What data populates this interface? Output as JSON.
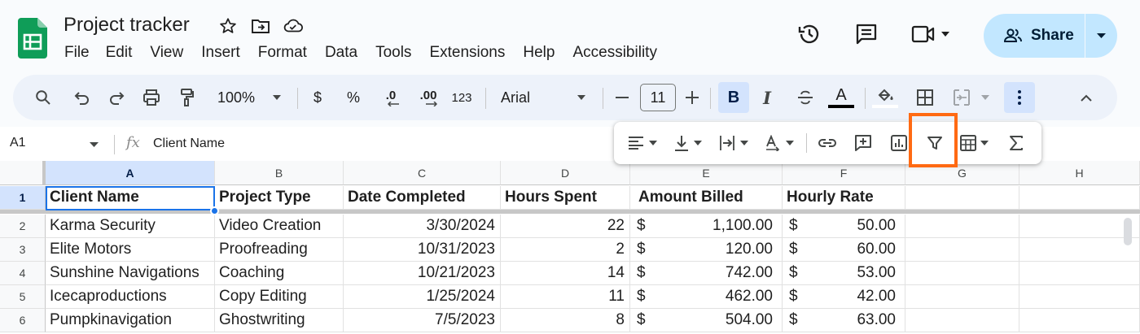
{
  "app": {
    "document_title": "Project tracker",
    "menu": [
      "File",
      "Edit",
      "View",
      "Insert",
      "Format",
      "Data",
      "Tools",
      "Extensions",
      "Help",
      "Accessibility"
    ],
    "share_label": "Share"
  },
  "toolbar": {
    "zoom": "100%",
    "currency": "$",
    "percent": "%",
    "decrease_decimal": ".0",
    "increase_decimal": ".00",
    "number_format": "123",
    "font": "Arial",
    "font_size": "11",
    "bold": "B",
    "italic": "I",
    "text_color": "A"
  },
  "formula_bar": {
    "name_box": "A1",
    "fx": "fx",
    "content": "Client Name"
  },
  "columns": [
    "A",
    "B",
    "C",
    "D",
    "E",
    "F",
    "G",
    "H"
  ],
  "rows": [
    {
      "num": "1",
      "cells": [
        "Client Name",
        "Project Type",
        "Date Completed",
        "Hours Spent",
        "Amount Billed",
        "Hourly Rate"
      ]
    },
    {
      "num": "2",
      "cells": [
        "Karma Security",
        "Video Creation",
        "3/30/2024",
        "22",
        {
          "cur": "$",
          "amt": "1,100.00"
        },
        {
          "cur": "$",
          "amt": "50.00"
        }
      ]
    },
    {
      "num": "3",
      "cells": [
        "Elite Motors",
        "Proofreading",
        "10/31/2023",
        "2",
        {
          "cur": "$",
          "amt": "120.00"
        },
        {
          "cur": "$",
          "amt": "60.00"
        }
      ]
    },
    {
      "num": "4",
      "cells": [
        "Sunshine Navigations",
        "Coaching",
        "10/21/2023",
        "14",
        {
          "cur": "$",
          "amt": "742.00"
        },
        {
          "cur": "$",
          "amt": "53.00"
        }
      ]
    },
    {
      "num": "5",
      "cells": [
        "Icecaproductions",
        "Copy Editing",
        "1/25/2024",
        "11",
        {
          "cur": "$",
          "amt": "462.00"
        },
        {
          "cur": "$",
          "amt": "42.00"
        }
      ]
    },
    {
      "num": "6",
      "cells": [
        "Pumpkinavigation",
        "Ghostwriting",
        "7/5/2023",
        "8",
        {
          "cur": "$",
          "amt": "504.00"
        },
        {
          "cur": "$",
          "amt": "63.00"
        }
      ]
    }
  ],
  "icons": {
    "title": [
      "star-icon",
      "move-to-folder-icon",
      "cloud-saved-icon"
    ],
    "top_right": [
      "version-history-icon",
      "comments-icon",
      "meet-video-icon"
    ],
    "toolbar": [
      "search-icon",
      "undo-icon",
      "redo-icon",
      "print-icon",
      "paint-format-icon"
    ],
    "overflow": [
      "horizontal-align-icon",
      "vertical-align-icon",
      "text-wrap-icon",
      "text-rotation-icon",
      "insert-link-icon",
      "insert-comment-icon",
      "insert-chart-icon",
      "create-filter-icon",
      "filter-views-icon",
      "functions-icon"
    ]
  },
  "colors": {
    "brand_green": "#0f9d58",
    "share_bg": "#c2e7ff",
    "selection": "#d3e3fd",
    "highlight_border": "#ff6a13"
  }
}
